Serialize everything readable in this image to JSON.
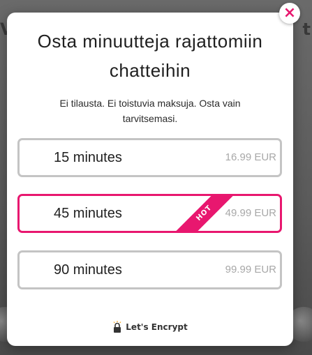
{
  "background": {
    "left_text": "V",
    "right_text": "t"
  },
  "modal": {
    "title": "Osta minuutteja rajattomiin chatteihin",
    "subtitle": "Ei tilausta. Ei toistuvia maksuja. Osta vain tarvitsemasi.",
    "close_icon": "×",
    "options": [
      {
        "duration": "15 minutes",
        "price": "16.99 EUR"
      },
      {
        "duration": "45 minutes",
        "price": "49.99 EUR",
        "badge": "HOT"
      },
      {
        "duration": "90 minutes",
        "price": "99.99 EUR"
      }
    ],
    "security": {
      "icon": "lock-icon",
      "label": "Let's Encrypt"
    }
  },
  "colors": {
    "accent": "#e8176f",
    "border": "#c4c4c4",
    "price": "#a8a8a8"
  }
}
